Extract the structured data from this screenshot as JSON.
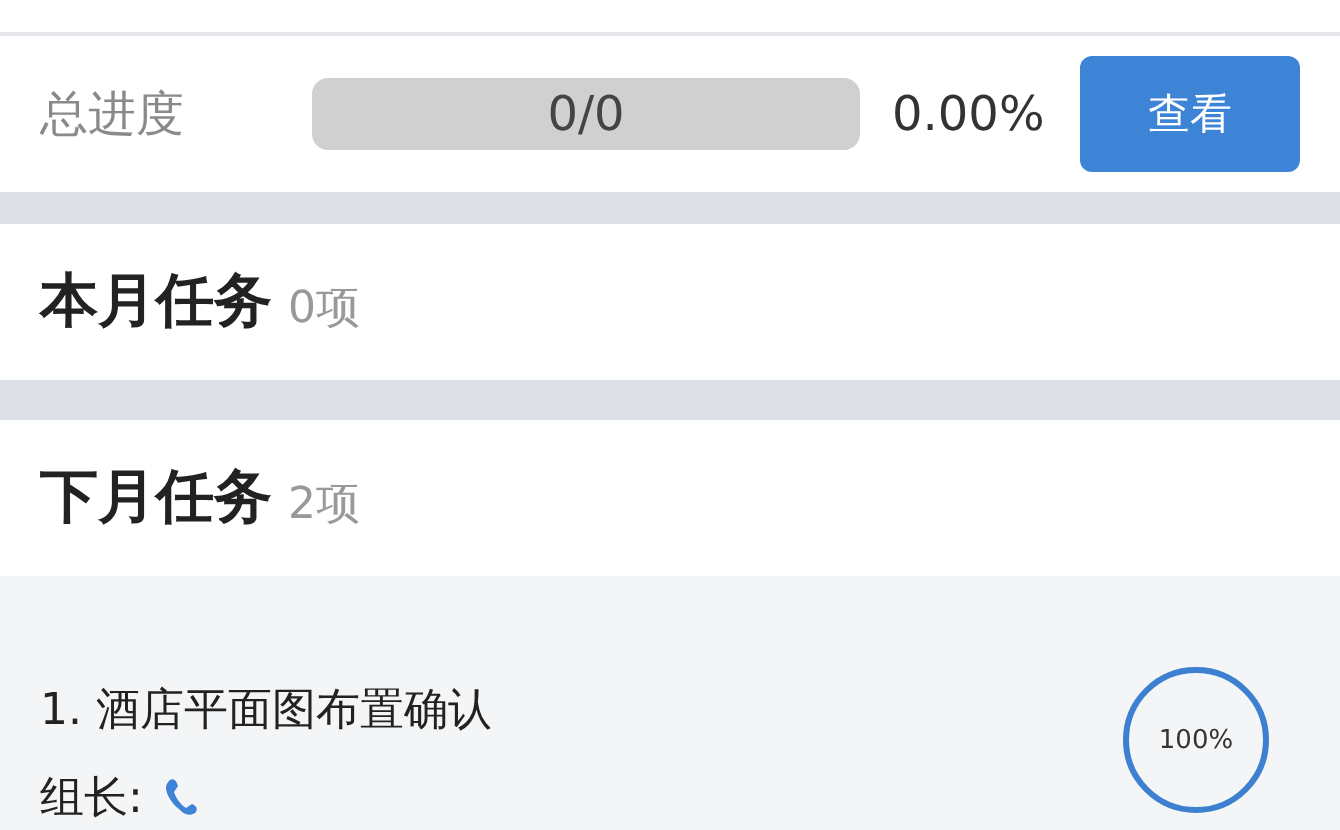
{
  "progress": {
    "label": "总进度",
    "bar_text": "0/0",
    "percent": "0.00%",
    "button": "查看"
  },
  "sections": [
    {
      "title": "本月任务",
      "count": "0项"
    },
    {
      "title": "下月任务",
      "count": "2项"
    }
  ],
  "tasks": [
    {
      "title": "1. 酒店平面图布置确认",
      "leader_label": "组长:",
      "ring_text": "100%",
      "level": 1
    }
  ]
}
